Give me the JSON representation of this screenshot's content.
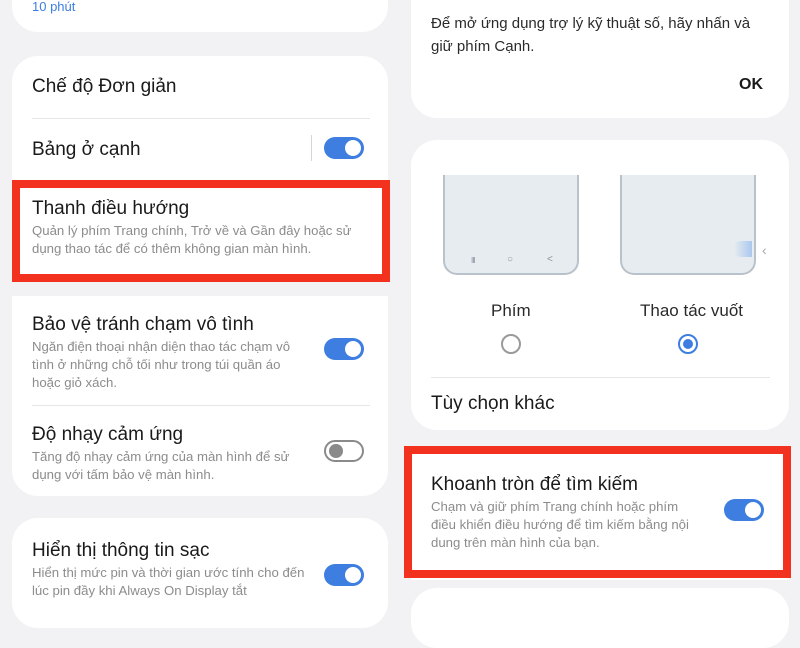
{
  "left": {
    "top_fragment": "10 phút",
    "simple_mode": "Chế độ Đơn giản",
    "edge_panels": {
      "title": "Bảng ở cạnh",
      "toggle": "on"
    },
    "navigation_bar": {
      "title": "Thanh điều hướng",
      "desc": "Quản lý phím Trang chính, Trở về và Gần đây hoặc sử dụng thao tác để có thêm không gian màn hình."
    },
    "accidental_touch": {
      "title": "Bảo vệ tránh chạm vô tình",
      "desc": "Ngăn điện thoại nhận diện thao tác chạm vô tình ở những chỗ tối như trong túi quần áo hoặc giỏ xách.",
      "toggle": "on"
    },
    "touch_sensitivity": {
      "title": "Độ nhạy cảm ứng",
      "desc": "Tăng độ nhạy cảm ứng của màn hình để sử dụng với tấm bảo vệ màn hình.",
      "toggle": "off"
    },
    "charging_info": {
      "title": "Hiển thị thông tin sạc",
      "desc": "Hiển thị mức pin và thời gian ước tính cho đến lúc pin đầy khi Always On Display tắt",
      "toggle": "on"
    }
  },
  "right": {
    "dialog": {
      "message": "Để mở ứng dụng trợ lý kỹ thuật số, hãy nhấn và giữ phím Cạnh.",
      "ok": "OK"
    },
    "nav_type": {
      "buttons_label": "Phím",
      "gestures_label": "Thao tác vuốt",
      "selected": "gestures",
      "nav_glyphs": [
        "III",
        "○",
        "<"
      ],
      "swipe_glyph": "‹"
    },
    "more_options": "Tùy chọn khác",
    "circle_to_search": {
      "title": "Khoanh tròn để tìm kiếm",
      "desc": "Chạm và giữ phím Trang chính hoặc phím điều khiển điều hướng để tìm kiếm bằng nội dung trên màn hình của bạn.",
      "toggle": "on"
    }
  },
  "colors": {
    "accent": "#3d7ee0",
    "highlight": "#f2321f",
    "background": "#f2f2f4"
  }
}
